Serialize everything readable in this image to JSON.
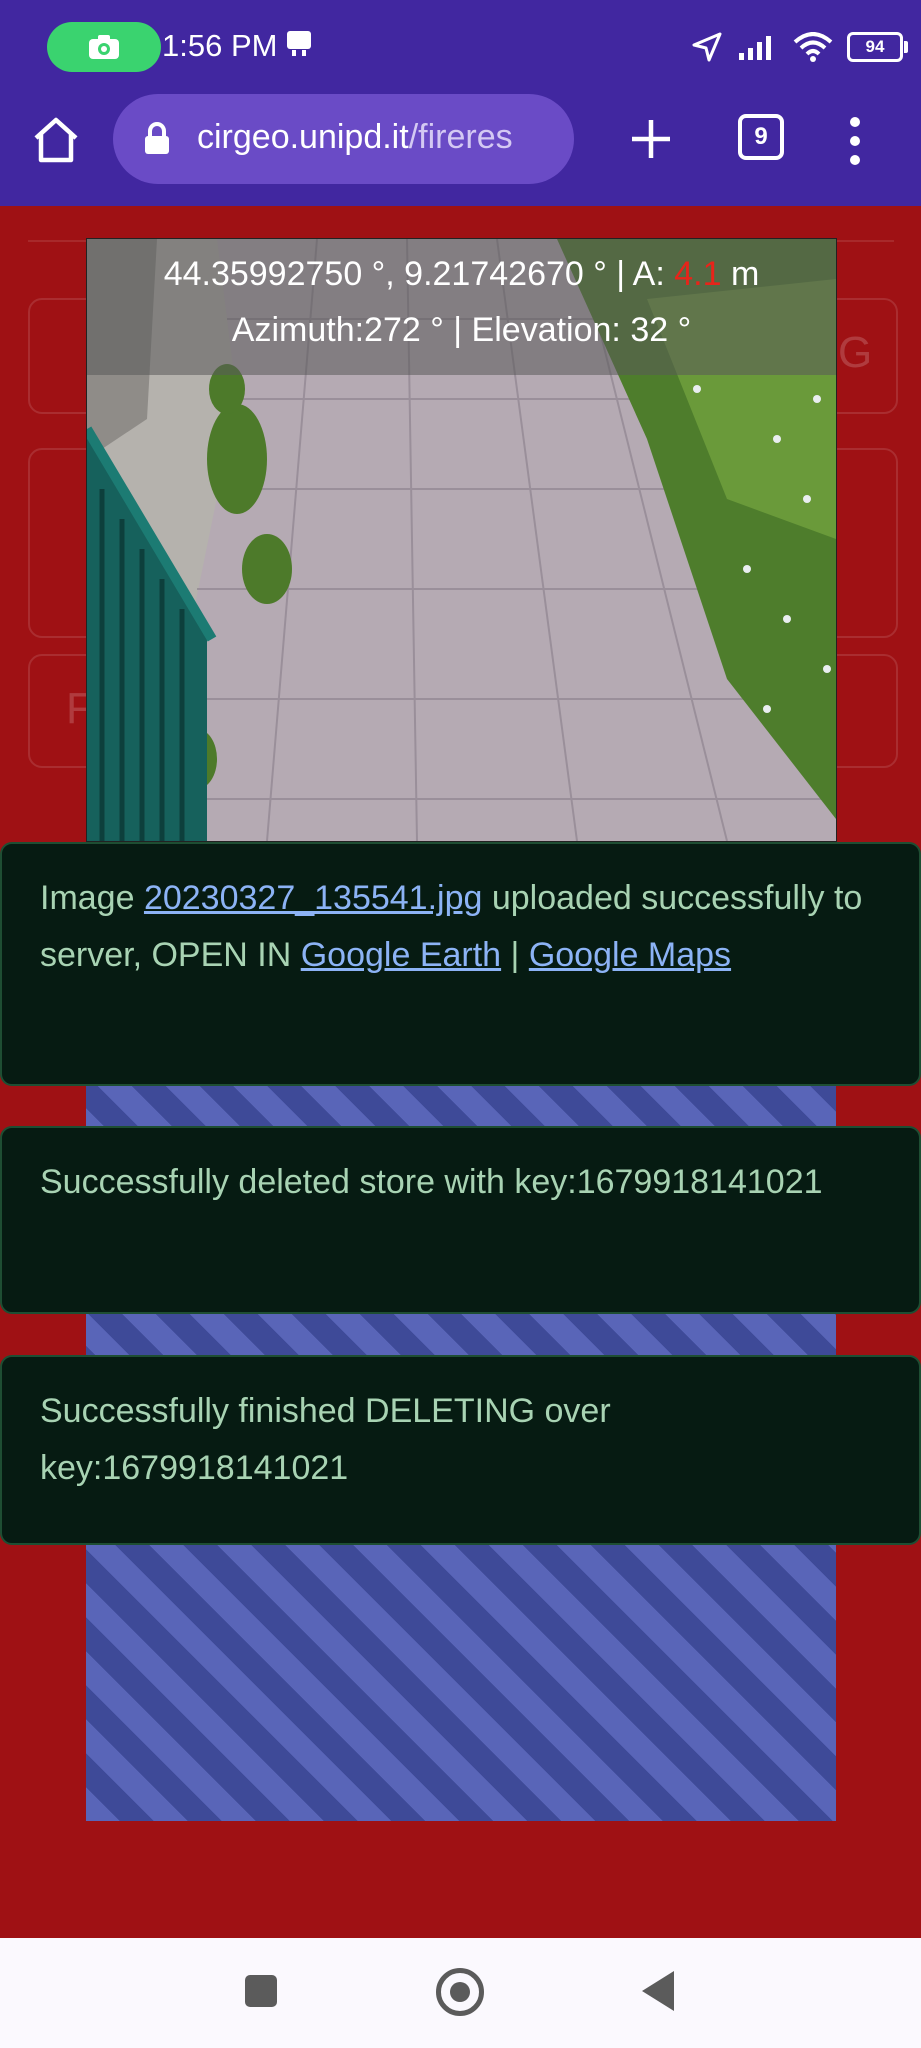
{
  "status_bar": {
    "time": "1:56 PM",
    "battery": "94",
    "icons": [
      "camera-icon",
      "ticket-icon",
      "location-arrow-icon",
      "signal-icon",
      "wifi-icon",
      "battery-icon"
    ]
  },
  "browser": {
    "url_domain": "cirgeo.unipd.it",
    "url_path": "/fireres",
    "tab_count": "9",
    "icons": [
      "home-icon",
      "lock-icon",
      "plus-icon",
      "tabs-icon",
      "more-vert-icon"
    ]
  },
  "photo_overlay": {
    "coordinates": "44.35992750 °, 9.21742670 ° |  A: ",
    "accuracy_value": "4.1",
    "accuracy_unit": " m",
    "orientation": "Azimuth:272 ° |  Elevation: 32 °"
  },
  "background_form": {
    "ghost_letter_right": "G",
    "ghost_letter_left": "F"
  },
  "toasts": [
    {
      "prefix": "Image ",
      "link_file": "20230327_135541.jpg",
      "middle": " uploaded successfully to server, OPEN IN ",
      "link_earth": "Google Earth",
      "separator": " |",
      "link_maps": "Google Maps"
    },
    {
      "text": "Successfully deleted store with key:1679918141021"
    },
    {
      "text": "Successfully finished DELETING over key:1679918141021"
    }
  ],
  "colors": {
    "status_bar": "#4127a0",
    "page_background": "#9f1114",
    "toast_background": "#061b12",
    "toast_text": "#a8d3b3",
    "link": "#8cb3f5",
    "accuracy": "#e8241a"
  }
}
